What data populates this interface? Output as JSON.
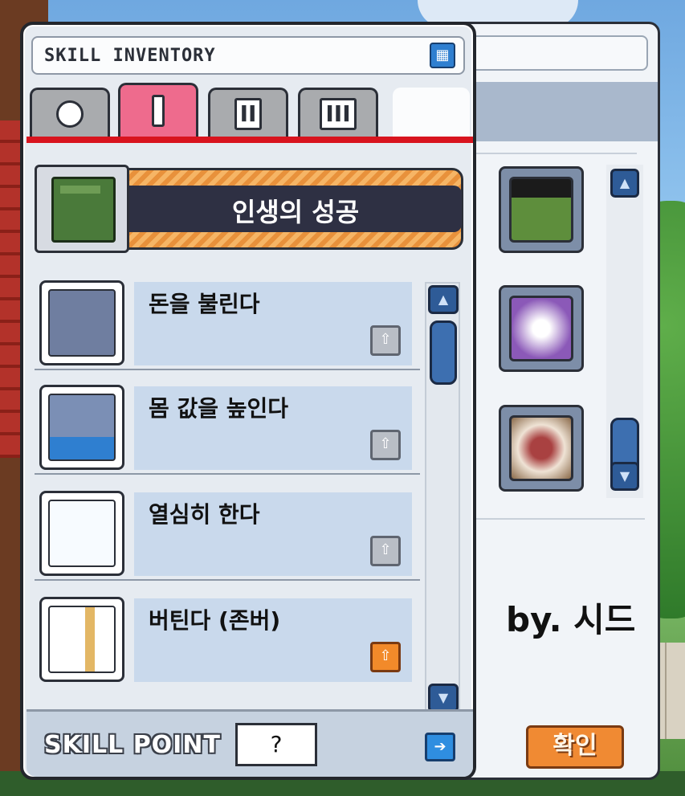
{
  "window": {
    "title": "SKILL INVENTORY",
    "close_icon": "grid-icon"
  },
  "tabs": [
    {
      "label": "○",
      "icon": "circle-icon",
      "active": false
    },
    {
      "label": "I",
      "active": true
    },
    {
      "label": "II",
      "active": false
    },
    {
      "label": "III",
      "active": false
    }
  ],
  "job": {
    "name": "인생의 성공",
    "icon": "book-icon"
  },
  "skills": [
    {
      "name": "돈을 불린다",
      "icon": "person-plus-icon",
      "upgrade_enabled": false
    },
    {
      "name": "몸 값을 높인다",
      "icon": "person-up-arrow-icon",
      "upgrade_enabled": false
    },
    {
      "name": "열심히 한다",
      "icon": "person-fairy-icon",
      "upgrade_enabled": false
    },
    {
      "name": "버틴다 (존버)",
      "icon": "person-shield-icon",
      "upgrade_enabled": true
    }
  ],
  "footer": {
    "skill_point_label": "SKILL POINT",
    "skill_point_value": "?"
  },
  "right_panel": {
    "credit": "by. 시드",
    "confirm_label": "확인"
  },
  "colors": {
    "active_tab": "#ee6b8d",
    "accent_red": "#d8141e",
    "orange": "#f3a64b",
    "scroll_blue": "#2e5b97"
  }
}
